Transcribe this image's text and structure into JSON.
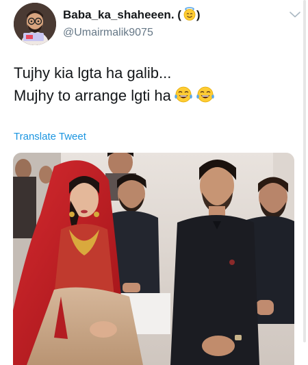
{
  "author": {
    "display_name": "Baba_ka_shaheeen. (",
    "display_name_close": ")",
    "handle": "@Umairmalik9075",
    "avatar_icon": "bitmoji-avatar-icon",
    "halo_emoji_icon": "smiling-face-with-halo-icon"
  },
  "tweet": {
    "line1": "Tujhy kia lgta ha galib...",
    "line2": "Mujhy to arrange lgti ha",
    "emoji_icon": "face-with-tears-of-joy-icon"
  },
  "translate_label": "Translate Tweet",
  "menu_icon": "chevron-down-icon",
  "colors": {
    "link": "#1b95e0",
    "handle": "#657786",
    "text": "#14171a",
    "bridal_red": "#b8151c"
  }
}
